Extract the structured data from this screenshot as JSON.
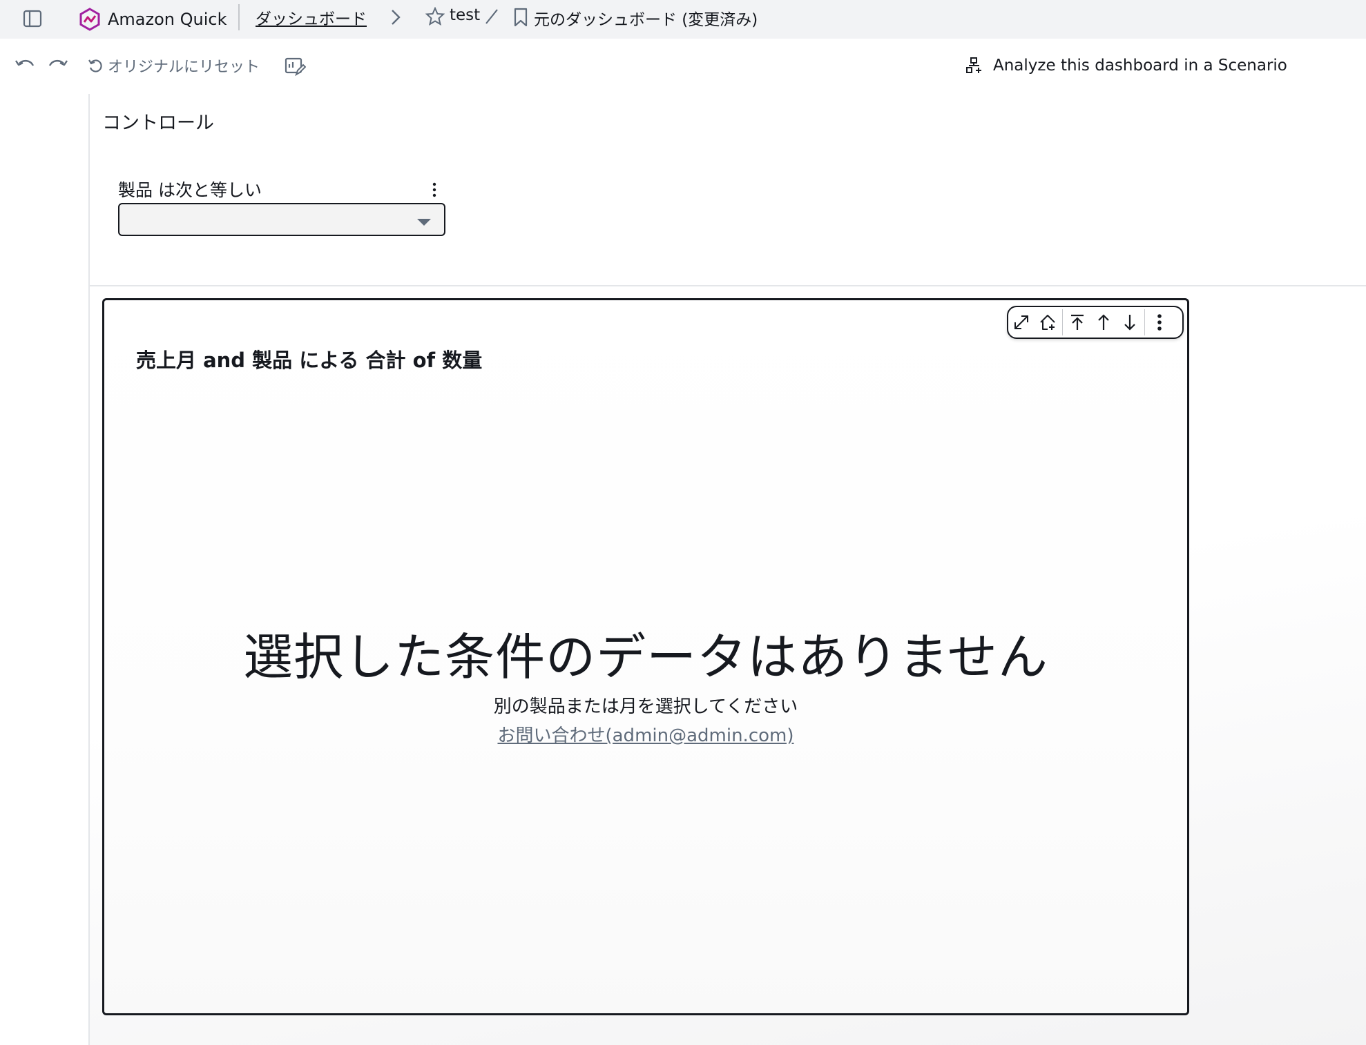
{
  "header": {
    "app_name": "Amazon Quick",
    "breadcrumb_dashboards": "ダッシュボード",
    "dashboard_name": "test",
    "view_name": "元のダッシュボード (変更済み)"
  },
  "toolbar": {
    "reset_label": "オリジナルにリセット",
    "scenario_label": "Analyze this dashboard in a Scenario"
  },
  "controls": {
    "title": "コントロール",
    "filter_label": "製品 は次と等しい",
    "filter_value": ""
  },
  "visual": {
    "title": "売上月 and 製品 による 合計 of 数量",
    "no_data_title": "選択した条件のデータはありません",
    "no_data_message": "別の製品または月を選択してください",
    "contact_link": "お問い合わせ(admin@admin.com)"
  },
  "icons": {
    "sidebar": "sidebar-toggle-icon",
    "logo": "amazon-quick-logo",
    "chevron": "chevron-right-icon",
    "star": "star-icon",
    "bookmark": "bookmark-icon",
    "undo": "undo-icon",
    "redo": "redo-icon",
    "reset": "reset-icon",
    "edit": "edit-visual-icon",
    "scenario": "scenario-icon",
    "expand": "expand-icon",
    "home": "home-icon",
    "move_top": "move-to-top-icon",
    "move_up": "move-up-icon",
    "move_down": "move-down-icon",
    "more": "more-options-icon"
  },
  "colors": {
    "topbar_bg": "#f2f3f5",
    "text": "#16191f",
    "muted": "#5f6b7a",
    "brand_logo": "#a020a0"
  }
}
